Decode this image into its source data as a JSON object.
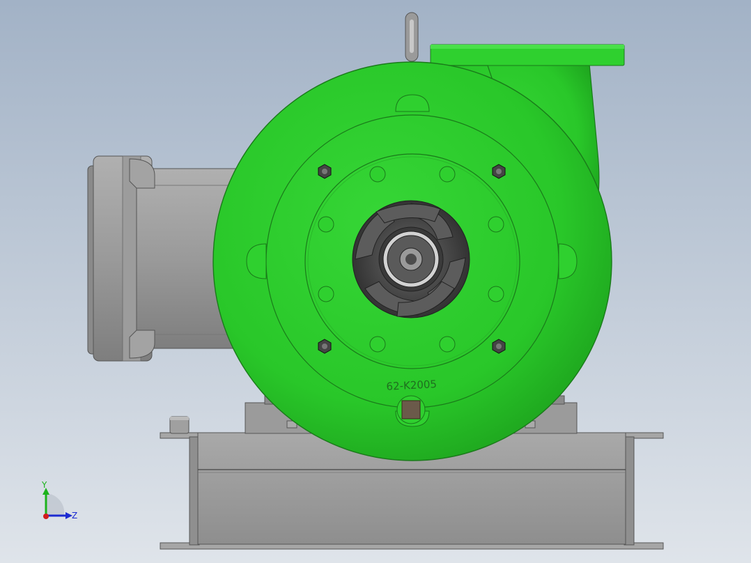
{
  "model": {
    "casing_marking": "62-K2005"
  },
  "triad": {
    "y_label": "Y",
    "z_label": "Z"
  },
  "colors": {
    "background_top": "#a3b3c7",
    "background_bottom": "#dde2e9",
    "casing_green": "#2ed12e",
    "casing_green_dark": "#1a9e1a",
    "metal_gray": "#9d9d9d",
    "metal_dark": "#7d7d7d",
    "impeller_dark": "#4a4a4a",
    "axis_y": "#1cb31c",
    "axis_z": "#1c2bd1",
    "axis_x": "#d11c1c"
  }
}
